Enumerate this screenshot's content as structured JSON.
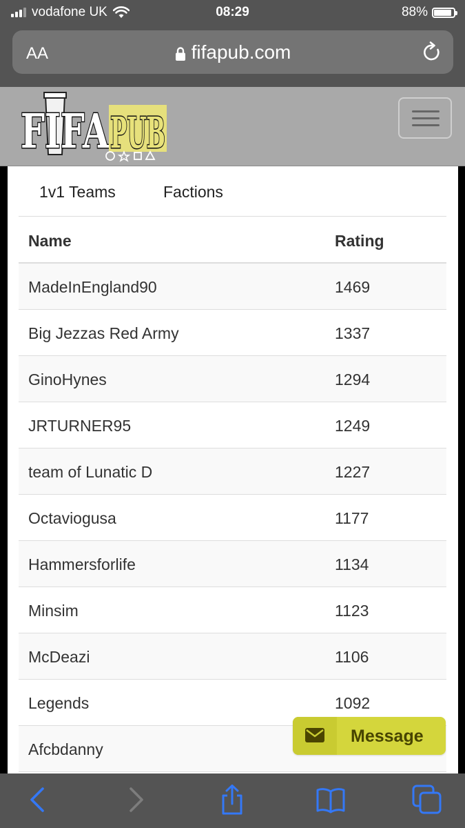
{
  "status_bar": {
    "carrier": "vodafone UK",
    "time": "08:29",
    "battery_percent_text": "88%",
    "battery_level": 0.88
  },
  "browser": {
    "text_size_label": "AA",
    "url": "fifapub.com"
  },
  "site": {
    "logo_text_left": "FIFA",
    "logo_text_right": "PUB"
  },
  "tabs": [
    {
      "label": "1v1 Teams"
    },
    {
      "label": "Factions"
    }
  ],
  "table": {
    "headers": {
      "name": "Name",
      "rating": "Rating"
    },
    "rows": [
      {
        "name": "MadeInEngland90",
        "rating": "1469"
      },
      {
        "name": "Big Jezzas Red Army",
        "rating": "1337"
      },
      {
        "name": "GinoHynes",
        "rating": "1294"
      },
      {
        "name": "JRTURNER95",
        "rating": "1249"
      },
      {
        "name": "team of Lunatic D",
        "rating": "1227"
      },
      {
        "name": "Octaviogusa",
        "rating": "1177"
      },
      {
        "name": "Hammersforlife",
        "rating": "1134"
      },
      {
        "name": "Minsim",
        "rating": "1123"
      },
      {
        "name": "McDeazi",
        "rating": "1106"
      },
      {
        "name": "Legends",
        "rating": "1092"
      },
      {
        "name": "Afcbdanny",
        "rating": ""
      }
    ]
  },
  "message_button": {
    "label": "Message"
  },
  "colors": {
    "accent": "#d4d63c",
    "link_blue": "#3478f6",
    "header_gray": "#a9a9a9"
  }
}
